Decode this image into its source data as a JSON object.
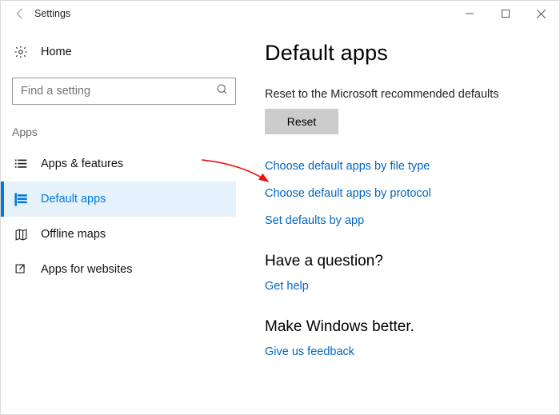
{
  "window": {
    "title": "Settings"
  },
  "sidebar": {
    "home": "Home",
    "search_placeholder": "Find a setting",
    "section": "Apps",
    "items": [
      {
        "label": "Apps & features"
      },
      {
        "label": "Default apps"
      },
      {
        "label": "Offline maps"
      },
      {
        "label": "Apps for websites"
      }
    ]
  },
  "main": {
    "heading": "Default apps",
    "reset_caption": "Reset to the Microsoft recommended defaults",
    "reset_button": "Reset",
    "links": {
      "by_file_type": "Choose default apps by file type",
      "by_protocol": "Choose default apps by protocol",
      "by_app": "Set defaults by app"
    },
    "question_heading": "Have a question?",
    "get_help": "Get help",
    "feedback_heading": "Make Windows better.",
    "give_feedback": "Give us feedback"
  }
}
